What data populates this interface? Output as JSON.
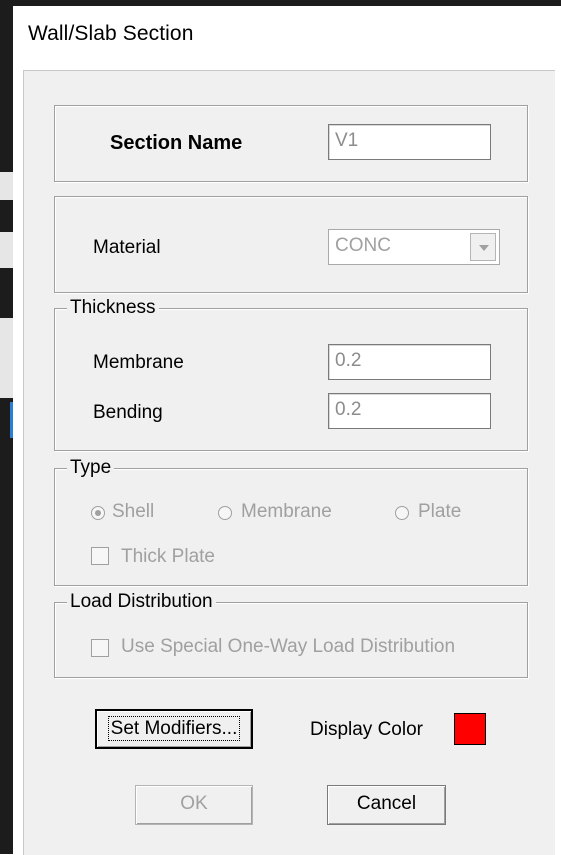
{
  "window": {
    "title": "Wall/Slab Section"
  },
  "section_name": {
    "label": "Section Name",
    "value": "V1"
  },
  "material": {
    "label": "Material",
    "selected": "CONC"
  },
  "thickness": {
    "legend": "Thickness",
    "membrane_label": "Membrane",
    "membrane_value": "0.2",
    "bending_label": "Bending",
    "bending_value": "0.2"
  },
  "type": {
    "legend": "Type",
    "options": [
      {
        "label": "Shell",
        "checked": true
      },
      {
        "label": "Membrane",
        "checked": false
      },
      {
        "label": "Plate",
        "checked": false
      }
    ],
    "thick_plate_label": "Thick Plate"
  },
  "load_distribution": {
    "legend": "Load Distribution",
    "one_way_label": "Use Special One-Way Load Distribution"
  },
  "buttons": {
    "set_modifiers": "Set Modifiers...",
    "ok": "OK",
    "cancel": "Cancel"
  },
  "display_color": {
    "label": "Display Color",
    "color": "#ff0000"
  },
  "icons": {
    "dropdown": "chevron-down-icon"
  }
}
